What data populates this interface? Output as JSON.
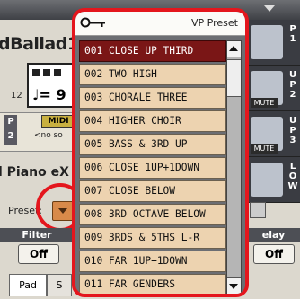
{
  "background": {
    "song_title": "dBallad1",
    "measure": "12",
    "tempo_prefix": "♩= 9",
    "p_label": "P\n2",
    "midi_badge": "MIDI",
    "no_song": "<no so",
    "piano_label": "l Piano eX",
    "preset_label": "Preset:",
    "filter_label": "Filter",
    "off_left": "Off",
    "delay_label": "elay",
    "off_right": "Off",
    "tab_pad": "Pad",
    "tab_s": "S",
    "upper_labels": [
      "P1",
      "UP2",
      "UP3",
      "LOW"
    ],
    "mute_tag": "MUTE"
  },
  "popup": {
    "title": "VP Preset",
    "items": [
      "001 CLOSE UP THIRD",
      "002 TWO HIGH",
      "003 CHORALE THREE",
      "004 HIGHER CHOIR",
      "005 BASS & 3RD UP",
      "006 CLOSE 1UP+1DOWN",
      "007 CLOSE BELOW",
      "008 3RD OCTAVE BELOW",
      "009 3RDS & 5THS L-R",
      "010 FAR 1UP+1DOWN",
      "011 FAR GENDERS"
    ],
    "selected_index": 0
  },
  "colors": {
    "highlight_red": "#e4161d",
    "item_bg": "#edd3b0",
    "selected_bg": "#7a1616"
  }
}
